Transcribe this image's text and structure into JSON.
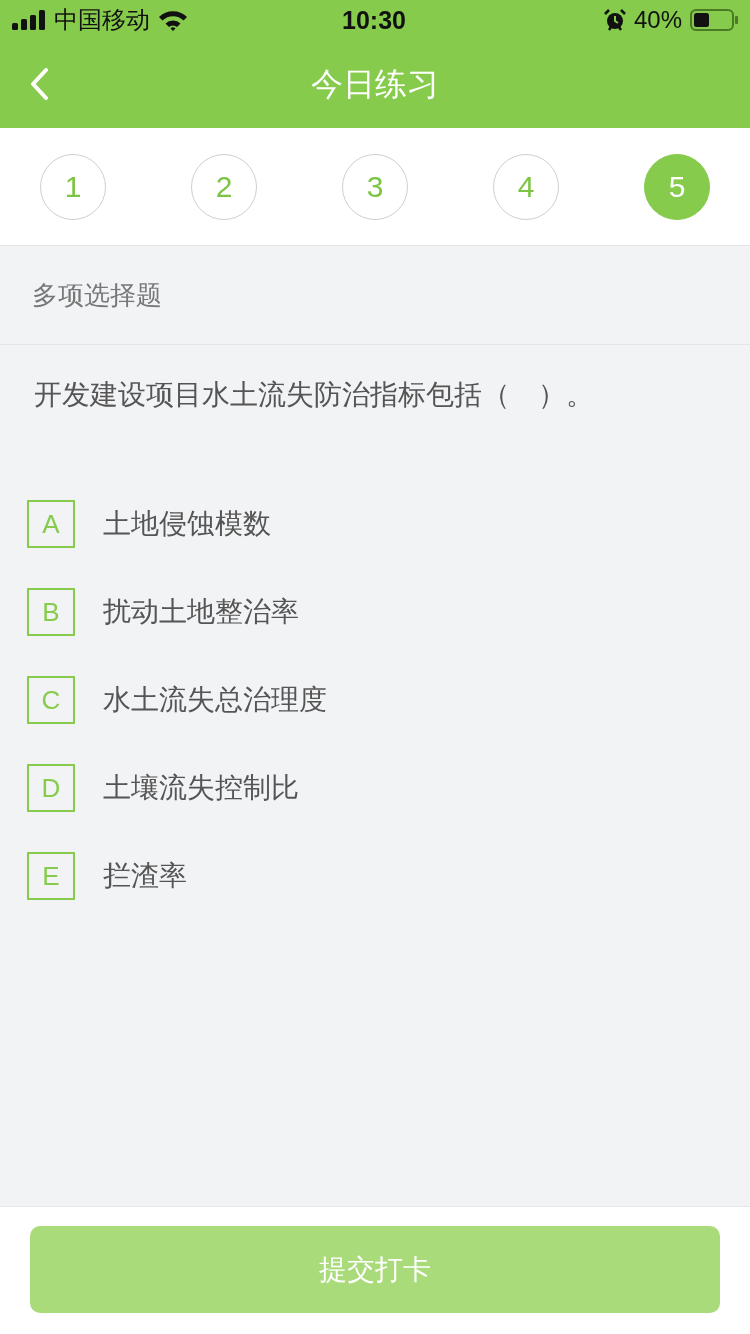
{
  "status_bar": {
    "carrier": "中国移动",
    "time": "10:30",
    "battery": "40%"
  },
  "nav_bar": {
    "title": "今日练习"
  },
  "question_tabs": [
    {
      "label": "1",
      "selected": false
    },
    {
      "label": "2",
      "selected": false
    },
    {
      "label": "3",
      "selected": false
    },
    {
      "label": "4",
      "selected": false
    },
    {
      "label": "5",
      "selected": true
    }
  ],
  "question": {
    "type_label": "多项选择题",
    "text": "开发建设项目水土流失防治指标包括（　）。",
    "options": [
      {
        "letter": "A",
        "text": "土地侵蚀模数",
        "selected": false
      },
      {
        "letter": "B",
        "text": "扰动土地整治率",
        "selected": false
      },
      {
        "letter": "C",
        "text": "水土流失总治理度",
        "selected": false
      },
      {
        "letter": "D",
        "text": "土壤流失控制比",
        "selected": false
      },
      {
        "letter": "E",
        "text": "拦渣率",
        "selected": false
      }
    ]
  },
  "submit_button": {
    "label": "提交打卡",
    "disabled": true
  }
}
